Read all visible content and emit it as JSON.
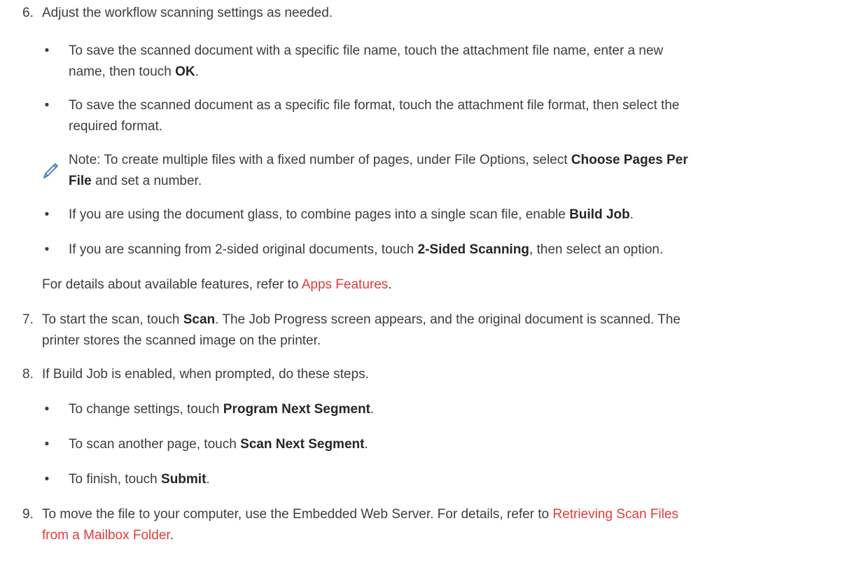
{
  "colors": {
    "text": "#3d3d3d",
    "bold_text": "#262626",
    "link": "#e23b3b",
    "note_icon": "#3a78c8"
  },
  "steps": {
    "s6": {
      "number": "6.",
      "text": "Adjust the workflow scanning settings as needed.",
      "bullet1": {
        "line1": "To save the scanned document with a specific file name, touch the attachment file name, enter a new",
        "line2_pre": "name, then touch ",
        "line2_bold": "OK",
        "line2_post": "."
      },
      "bullet2": {
        "line1": "To save the scanned document as a specific file format, touch the attachment file format, then select the",
        "line2": "required format."
      },
      "note": {
        "icon": "pencil-icon",
        "line1_pre": "Note: To create multiple files with a fixed number of pages, under File Options, select ",
        "line1_bold": "Choose Pages Per",
        "line2_bold": "File",
        "line2_post": " and set a number."
      },
      "bullet3": {
        "pre": "If you are using the document glass, to combine pages into a single scan file, enable ",
        "bold": "Build Job",
        "post": "."
      },
      "bullet4": {
        "pre": "If you are scanning from 2-sided original documents, touch ",
        "bold": "2-Sided Scanning",
        "post": ", then select an option."
      },
      "details": {
        "pre": "For details about available features, refer to ",
        "link": "Apps Features",
        "post": "."
      }
    },
    "s7": {
      "number": "7.",
      "line1_pre": "To start the scan, touch ",
      "line1_bold": "Scan",
      "line1_post": ". The Job Progress screen appears, and the original document is scanned. The",
      "line2": "printer stores the scanned image on the printer."
    },
    "s8": {
      "number": "8.",
      "text": "If Build Job is enabled, when prompted, do these steps.",
      "bullet1": {
        "pre": "To change settings, touch ",
        "bold": "Program Next Segment",
        "post": "."
      },
      "bullet2": {
        "pre": "To scan another page, touch ",
        "bold": "Scan Next Segment",
        "post": "."
      },
      "bullet3": {
        "pre": "To finish, touch ",
        "bold": "Submit",
        "post": "."
      }
    },
    "s9": {
      "number": "9.",
      "line1_pre": "To move the file to your computer, use the Embedded Web Server. For details, refer to ",
      "line1_link": "Retrieving Scan Files",
      "line2_link": "from a Mailbox Folder",
      "line2_post": "."
    },
    "bullet_char": "•"
  }
}
